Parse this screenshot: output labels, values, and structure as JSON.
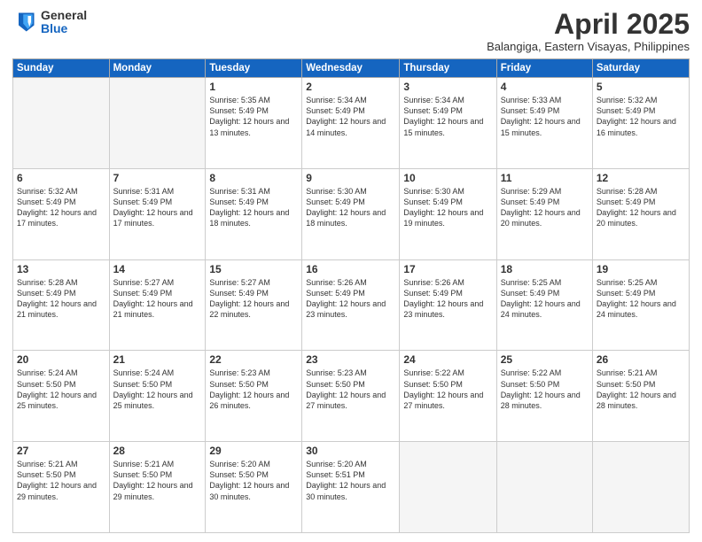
{
  "header": {
    "logo_general": "General",
    "logo_blue": "Blue",
    "month_title": "April 2025",
    "subtitle": "Balangiga, Eastern Visayas, Philippines"
  },
  "days_of_week": [
    "Sunday",
    "Monday",
    "Tuesday",
    "Wednesday",
    "Thursday",
    "Friday",
    "Saturday"
  ],
  "weeks": [
    [
      {
        "day": "",
        "info": ""
      },
      {
        "day": "",
        "info": ""
      },
      {
        "day": "1",
        "info": "Sunrise: 5:35 AM\nSunset: 5:49 PM\nDaylight: 12 hours\nand 13 minutes."
      },
      {
        "day": "2",
        "info": "Sunrise: 5:34 AM\nSunset: 5:49 PM\nDaylight: 12 hours\nand 14 minutes."
      },
      {
        "day": "3",
        "info": "Sunrise: 5:34 AM\nSunset: 5:49 PM\nDaylight: 12 hours\nand 15 minutes."
      },
      {
        "day": "4",
        "info": "Sunrise: 5:33 AM\nSunset: 5:49 PM\nDaylight: 12 hours\nand 15 minutes."
      },
      {
        "day": "5",
        "info": "Sunrise: 5:32 AM\nSunset: 5:49 PM\nDaylight: 12 hours\nand 16 minutes."
      }
    ],
    [
      {
        "day": "6",
        "info": "Sunrise: 5:32 AM\nSunset: 5:49 PM\nDaylight: 12 hours\nand 17 minutes."
      },
      {
        "day": "7",
        "info": "Sunrise: 5:31 AM\nSunset: 5:49 PM\nDaylight: 12 hours\nand 17 minutes."
      },
      {
        "day": "8",
        "info": "Sunrise: 5:31 AM\nSunset: 5:49 PM\nDaylight: 12 hours\nand 18 minutes."
      },
      {
        "day": "9",
        "info": "Sunrise: 5:30 AM\nSunset: 5:49 PM\nDaylight: 12 hours\nand 18 minutes."
      },
      {
        "day": "10",
        "info": "Sunrise: 5:30 AM\nSunset: 5:49 PM\nDaylight: 12 hours\nand 19 minutes."
      },
      {
        "day": "11",
        "info": "Sunrise: 5:29 AM\nSunset: 5:49 PM\nDaylight: 12 hours\nand 20 minutes."
      },
      {
        "day": "12",
        "info": "Sunrise: 5:28 AM\nSunset: 5:49 PM\nDaylight: 12 hours\nand 20 minutes."
      }
    ],
    [
      {
        "day": "13",
        "info": "Sunrise: 5:28 AM\nSunset: 5:49 PM\nDaylight: 12 hours\nand 21 minutes."
      },
      {
        "day": "14",
        "info": "Sunrise: 5:27 AM\nSunset: 5:49 PM\nDaylight: 12 hours\nand 21 minutes."
      },
      {
        "day": "15",
        "info": "Sunrise: 5:27 AM\nSunset: 5:49 PM\nDaylight: 12 hours\nand 22 minutes."
      },
      {
        "day": "16",
        "info": "Sunrise: 5:26 AM\nSunset: 5:49 PM\nDaylight: 12 hours\nand 23 minutes."
      },
      {
        "day": "17",
        "info": "Sunrise: 5:26 AM\nSunset: 5:49 PM\nDaylight: 12 hours\nand 23 minutes."
      },
      {
        "day": "18",
        "info": "Sunrise: 5:25 AM\nSunset: 5:49 PM\nDaylight: 12 hours\nand 24 minutes."
      },
      {
        "day": "19",
        "info": "Sunrise: 5:25 AM\nSunset: 5:49 PM\nDaylight: 12 hours\nand 24 minutes."
      }
    ],
    [
      {
        "day": "20",
        "info": "Sunrise: 5:24 AM\nSunset: 5:50 PM\nDaylight: 12 hours\nand 25 minutes."
      },
      {
        "day": "21",
        "info": "Sunrise: 5:24 AM\nSunset: 5:50 PM\nDaylight: 12 hours\nand 25 minutes."
      },
      {
        "day": "22",
        "info": "Sunrise: 5:23 AM\nSunset: 5:50 PM\nDaylight: 12 hours\nand 26 minutes."
      },
      {
        "day": "23",
        "info": "Sunrise: 5:23 AM\nSunset: 5:50 PM\nDaylight: 12 hours\nand 27 minutes."
      },
      {
        "day": "24",
        "info": "Sunrise: 5:22 AM\nSunset: 5:50 PM\nDaylight: 12 hours\nand 27 minutes."
      },
      {
        "day": "25",
        "info": "Sunrise: 5:22 AM\nSunset: 5:50 PM\nDaylight: 12 hours\nand 28 minutes."
      },
      {
        "day": "26",
        "info": "Sunrise: 5:21 AM\nSunset: 5:50 PM\nDaylight: 12 hours\nand 28 minutes."
      }
    ],
    [
      {
        "day": "27",
        "info": "Sunrise: 5:21 AM\nSunset: 5:50 PM\nDaylight: 12 hours\nand 29 minutes."
      },
      {
        "day": "28",
        "info": "Sunrise: 5:21 AM\nSunset: 5:50 PM\nDaylight: 12 hours\nand 29 minutes."
      },
      {
        "day": "29",
        "info": "Sunrise: 5:20 AM\nSunset: 5:50 PM\nDaylight: 12 hours\nand 30 minutes."
      },
      {
        "day": "30",
        "info": "Sunrise: 5:20 AM\nSunset: 5:51 PM\nDaylight: 12 hours\nand 30 minutes."
      },
      {
        "day": "",
        "info": ""
      },
      {
        "day": "",
        "info": ""
      },
      {
        "day": "",
        "info": ""
      }
    ]
  ]
}
